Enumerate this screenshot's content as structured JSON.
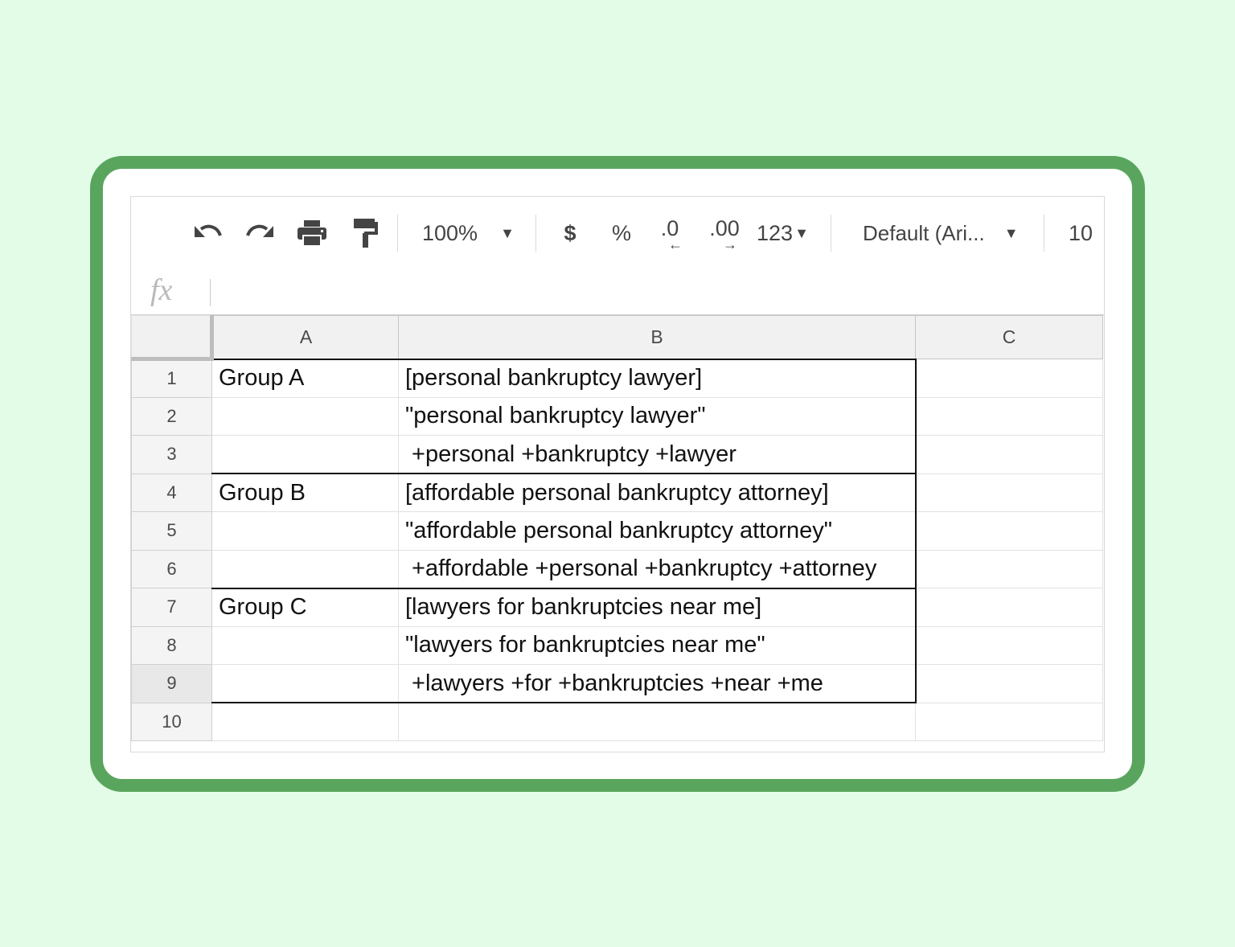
{
  "toolbar": {
    "zoom": "100%",
    "currency_label": "$",
    "percent_label": "%",
    "decrease_decimal_label": ".0",
    "increase_decimal_label": ".00",
    "number_format_label": "123",
    "font_name": "Default (Ari...",
    "font_size": "10"
  },
  "formula_bar": {
    "fx_label": "fx",
    "value": ""
  },
  "columns": [
    "A",
    "B",
    "C"
  ],
  "rows": [
    {
      "num": "1",
      "a": "Group A",
      "b": "[personal bankruptcy lawyer]",
      "c": ""
    },
    {
      "num": "2",
      "a": "",
      "b": "\"personal bankruptcy lawyer\"",
      "c": ""
    },
    {
      "num": "3",
      "a": "",
      "b": " +personal +bankruptcy +lawyer",
      "c": ""
    },
    {
      "num": "4",
      "a": "Group B",
      "b": "[affordable personal bankruptcy attorney]",
      "c": ""
    },
    {
      "num": "5",
      "a": "",
      "b": "\"affordable personal bankruptcy attorney\"",
      "c": ""
    },
    {
      "num": "6",
      "a": "",
      "b": " +affordable +personal +bankruptcy +attorney",
      "c": ""
    },
    {
      "num": "7",
      "a": "Group C",
      "b": "[lawyers for bankruptcies near me]",
      "c": ""
    },
    {
      "num": "8",
      "a": "",
      "b": "\"lawyers for bankruptcies near me\"",
      "c": ""
    },
    {
      "num": "9",
      "a": "",
      "b": " +lawyers +for +bankruptcies +near +me",
      "c": ""
    },
    {
      "num": "10",
      "a": "",
      "b": "",
      "c": ""
    }
  ],
  "colors": {
    "page_background": "#e3fce8",
    "frame_border": "#5aa55e",
    "group_border": "#111111"
  },
  "icons": [
    "undo-icon",
    "redo-icon",
    "print-icon",
    "paint-format-icon",
    "dropdown-caret-icon"
  ]
}
